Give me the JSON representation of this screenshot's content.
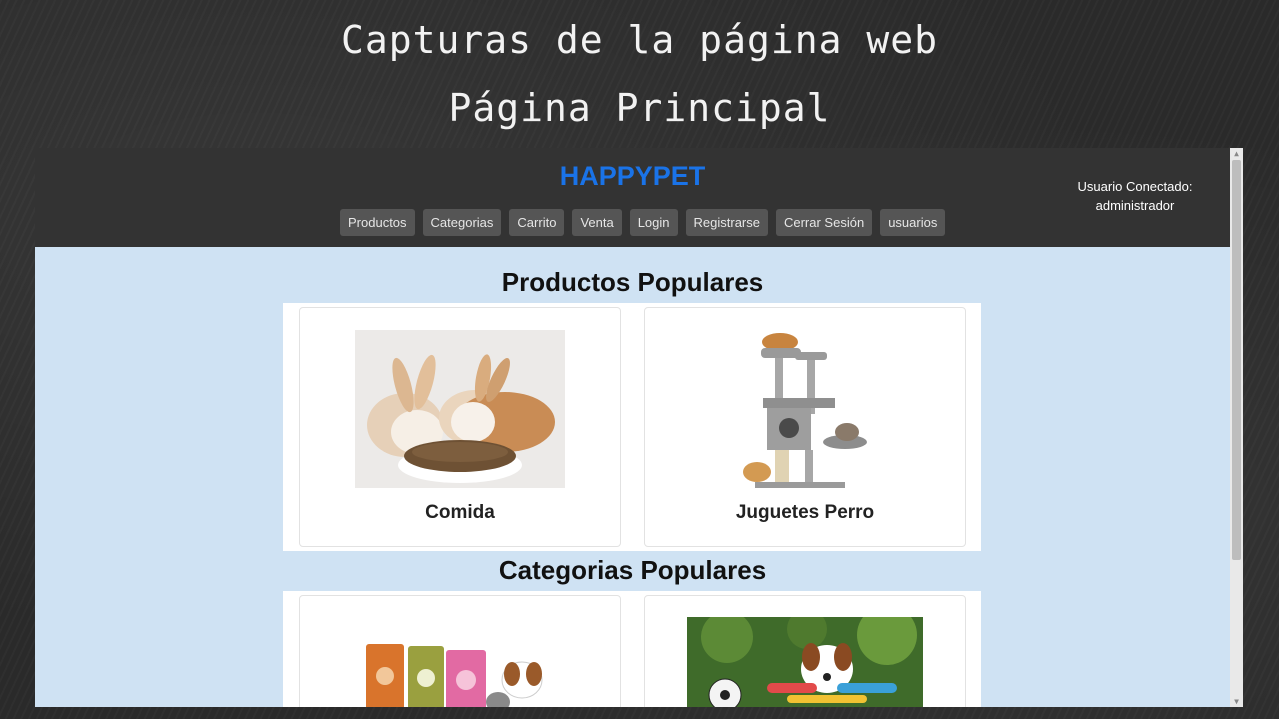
{
  "slide": {
    "title": "Capturas de la página web",
    "subtitle": "Página Principal"
  },
  "navbar": {
    "brand": "HAPPYPET",
    "menu": [
      "Productos",
      "Categorias",
      "Carrito",
      "Venta",
      "Login",
      "Registrarse",
      "Cerrar Sesión",
      "usuarios"
    ],
    "user_label": "Usuario Conectado:",
    "user_name": "administrador"
  },
  "products_section": {
    "heading": "Productos Populares",
    "items": [
      {
        "name": "Comida"
      },
      {
        "name": "Juguetes Perro"
      }
    ]
  },
  "categories_section": {
    "heading": "Categorias Populares"
  },
  "colors": {
    "brand": "#1a73e8",
    "navbar_bg": "#333333",
    "page_bg": "#cfe2f3"
  }
}
